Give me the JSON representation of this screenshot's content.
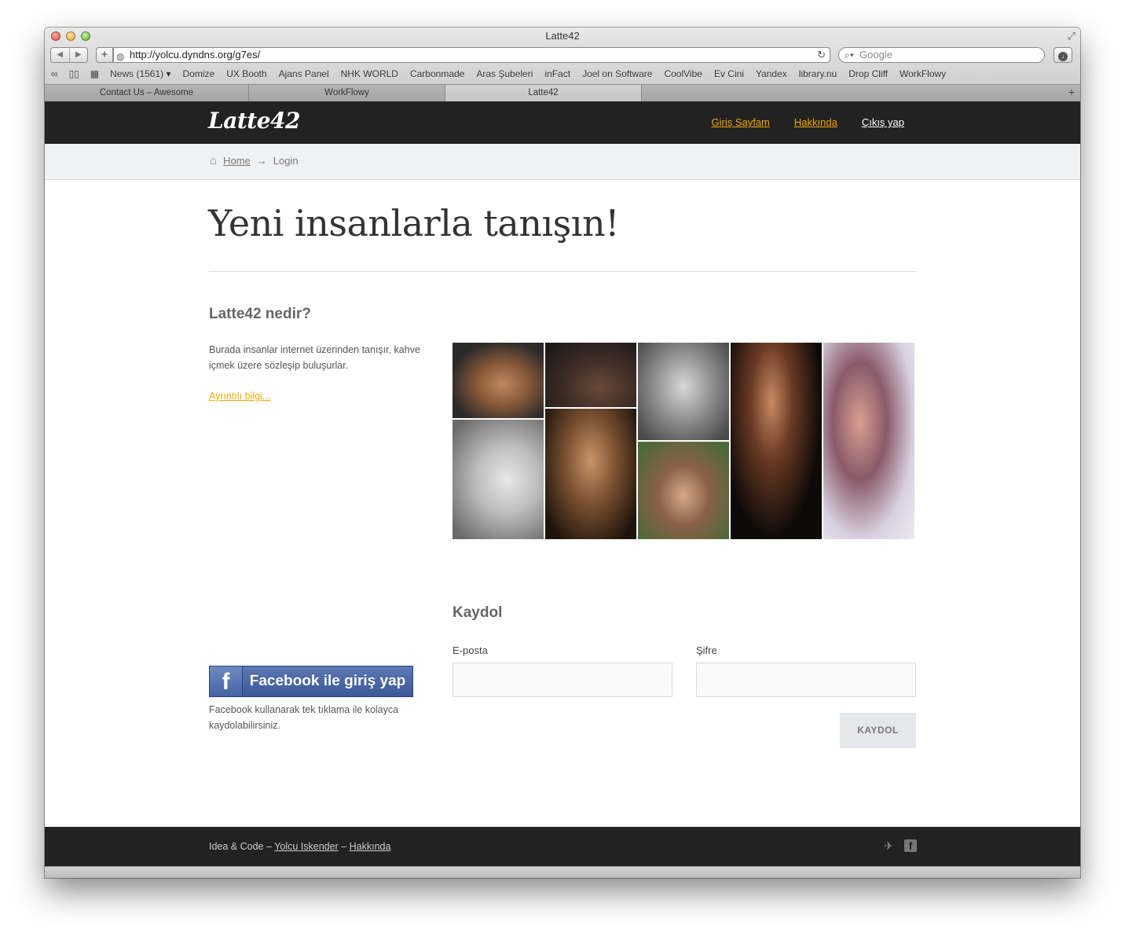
{
  "window": {
    "title": "Latte42"
  },
  "toolbar": {
    "back": "◀",
    "forward": "▶",
    "add": "+",
    "url": "http://yolcu.dyndns.org/g7es/",
    "search_placeholder": "Google"
  },
  "bookmarks": [
    "News (1561) ▾",
    "Domize",
    "UX Booth",
    "Ajans Panel",
    "NHK WORLD",
    "Carbonmade",
    "Aras Şubeleri",
    "inFact",
    "Joel on Software",
    "CoolVibe",
    "Ev Cini",
    "Yandex",
    "library.nu",
    "Drop Cliff",
    "WorkFlowy"
  ],
  "tabs": [
    {
      "label": "Contact Us – Awesome",
      "active": false
    },
    {
      "label": "WorkFlowy",
      "active": false
    },
    {
      "label": "Latte42",
      "active": true
    }
  ],
  "site": {
    "logo": "Latte42",
    "nav": [
      "Giriş Sayfam",
      "Hakkında",
      "Çıkış yap"
    ],
    "breadcrumb": {
      "home": "Home",
      "arrow": "→",
      "current": "Login"
    },
    "headline": "Yeni insanlarla tanışın!",
    "about_title": "Latte42 nedir?",
    "about_text": "Burada insanlar internet üzerinden tanışır, kahve içmek üzere sözleşip buluşurlar.",
    "more_link": "Ayrıntılı bilgi...",
    "facebook_button": "Facebook ile giriş yap",
    "facebook_note": "Facebook kullanarak tek tıklama ile kolayca kaydolabilirsiniz.",
    "signup": {
      "title": "Kaydol",
      "email_label": "E-posta",
      "password_label": "Şifre",
      "submit": "KAYDOL"
    },
    "footer": {
      "prefix": "Idea & Code –",
      "author": "Yolcu Iskender",
      "sep": "–",
      "about": "Hakkında"
    }
  },
  "colors": {
    "accent": "#f5a800",
    "topbar": "#222222",
    "facebook": "#3b5998"
  },
  "icons": [
    "reading-glasses-icon",
    "book-icon",
    "grid-icon",
    "home-icon",
    "twitter-icon",
    "facebook-icon",
    "download-icon",
    "globe-icon",
    "reload-icon",
    "search-icon"
  ]
}
